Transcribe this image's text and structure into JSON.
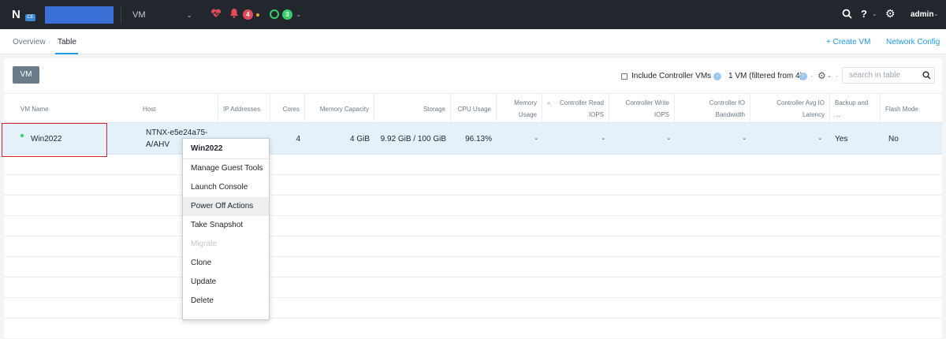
{
  "header": {
    "logo_text": "N",
    "logo_edition": "CE",
    "entity_selector": "VM",
    "alert_count": "4",
    "task_count": "3",
    "help_label": "?",
    "user": "admin",
    "icons": {
      "health": "heart-pulse-icon",
      "alerts": "bell-icon",
      "search": "search-icon",
      "settings": "gear-icon"
    },
    "colors": {
      "bar": "#22272e",
      "cluster": "#3a6fd6",
      "alert": "#e34b5a",
      "task": "#36d068",
      "accent": "#1b9cea"
    }
  },
  "subnav": {
    "tabs": [
      "Overview",
      "Table"
    ],
    "separator": "·",
    "active_tab": "Table",
    "actions": [
      "+ Create VM",
      "Network Config"
    ]
  },
  "toolbar": {
    "vm_button": "VM",
    "include_controller_label": "Include Controller VMs",
    "pagination": "1 VM (filtered from 4)",
    "search_placeholder": "search in table"
  },
  "table": {
    "columns": [
      "VM Name",
      "Host",
      "IP Addresses",
      "Cores",
      "Memory Capacity",
      "Storage",
      "CPU Usage",
      "Memory Usage",
      "Controller Read IOPS",
      "Controller Write IOPS",
      "Controller IO Bandwidth",
      "Controller Avg IO Latency",
      "Backup and ...",
      "Flash Mode"
    ],
    "rows": [
      {
        "name": "Win2022",
        "host_line1": "NTNX-e5e24a75-",
        "host_line2": "A/AHV",
        "ip": "",
        "cores": "4",
        "memory": "4 GiB",
        "storage": "9.92 GiB / 100 GiB",
        "cpu": "96.13%",
        "mem_usage": "-",
        "ctrl_read": "-",
        "ctrl_write": "-",
        "ctrl_bw": "-",
        "ctrl_lat": "-",
        "backup": "Yes",
        "flash": "No",
        "power_state_color": "#36d068"
      }
    ]
  },
  "context_menu": {
    "title": "Win2022",
    "items": [
      "Manage Guest Tools",
      "Launch Console",
      "Power Off Actions",
      "Take Snapshot",
      "Migrate",
      "Clone",
      "Update",
      "Delete"
    ],
    "hovered": "Power Off Actions",
    "disabled": [
      "Migrate"
    ]
  }
}
